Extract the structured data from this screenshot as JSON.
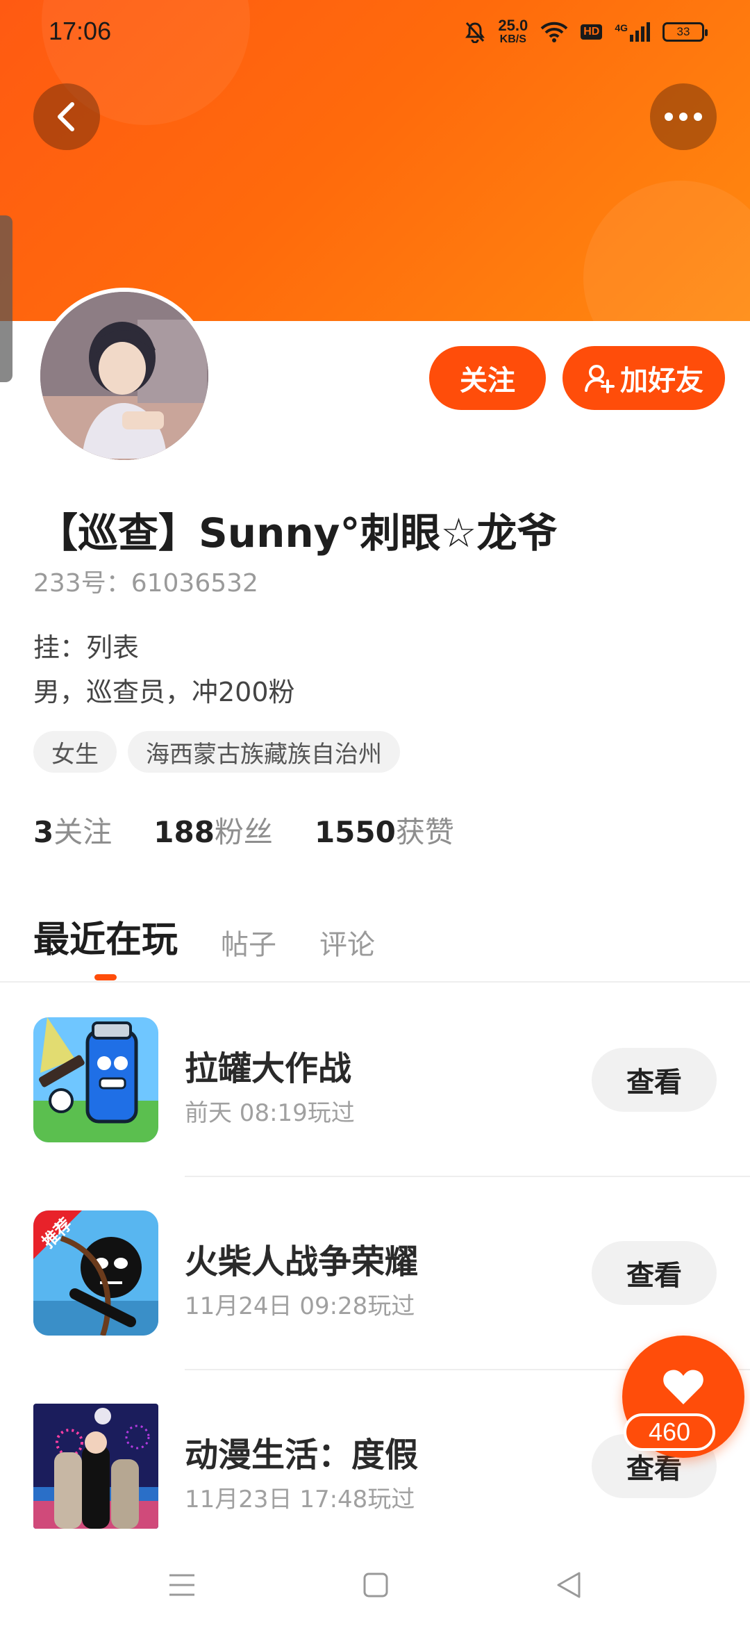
{
  "status_bar": {
    "time": "17:06",
    "net_speed_value": "25.0",
    "net_speed_unit": "KB/S",
    "hd_label": "HD",
    "network_type": "4G",
    "battery": "33",
    "icons": [
      "mute-bell-icon",
      "wifi-icon",
      "hd-icon",
      "signal-icon",
      "battery-icon"
    ]
  },
  "header": {
    "back_icon": "chevron-left-icon",
    "more_icon": "ellipsis-icon",
    "accent_color": "#ff5a12"
  },
  "profile": {
    "follow_label": "关注",
    "add_friend_label": "加好友",
    "nickname": "【巡查】Sunny°刺眼☆龙爷",
    "uid": "233号：61036532",
    "bio_line1": "挂：列表",
    "bio_line2": "男，巡查员，冲200粉",
    "tags": [
      "女生",
      "海西蒙古族藏族自治州"
    ],
    "stats": [
      {
        "num": "3",
        "label": "关注"
      },
      {
        "num": "188",
        "label": "粉丝"
      },
      {
        "num": "1550",
        "label": "获赞"
      }
    ]
  },
  "tabs": [
    {
      "label": "最近在玩",
      "active": true
    },
    {
      "label": "帖子",
      "active": false
    },
    {
      "label": "评论",
      "active": false
    }
  ],
  "games": [
    {
      "name": "拉罐大作战",
      "time": "前天 08:19玩过",
      "button": "查看"
    },
    {
      "name": "火柴人战争荣耀",
      "time": "11月24日 09:28玩过",
      "button": "查看",
      "badge": "推荐"
    },
    {
      "name": "动漫生活：度假",
      "time": "11月23日 17:48玩过",
      "button": "查看"
    }
  ],
  "like_fab": {
    "icon": "heart-icon",
    "count": "460"
  },
  "nav": {
    "icons": [
      "menu-icon",
      "home-square-icon",
      "back-triangle-icon"
    ]
  }
}
